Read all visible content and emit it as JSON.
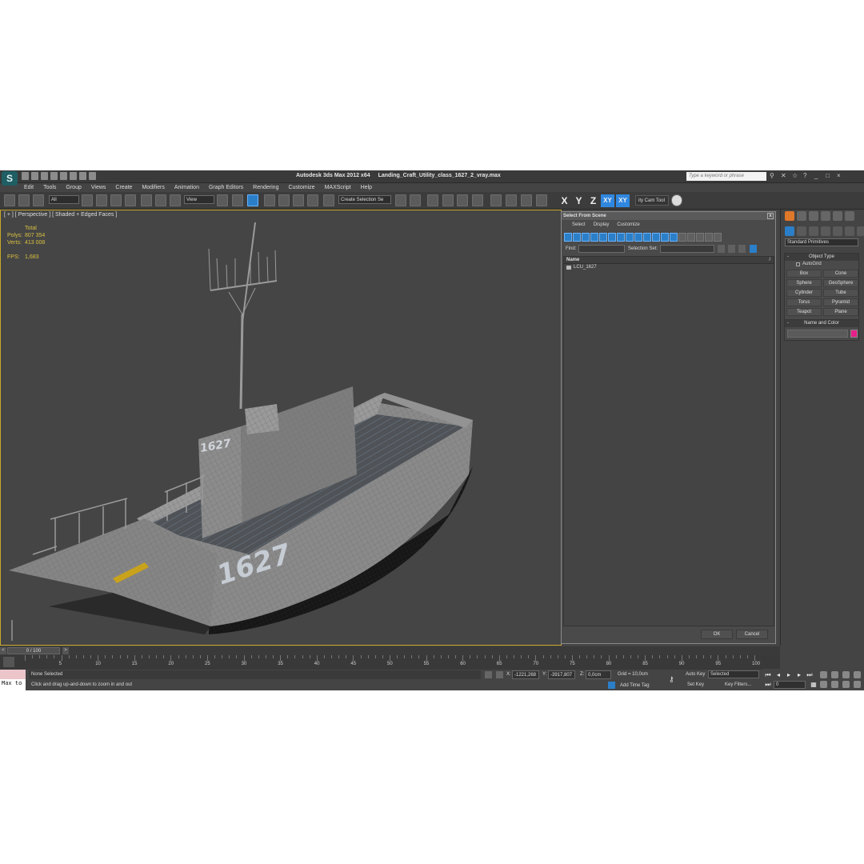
{
  "app": {
    "title": "Autodesk 3ds Max  2012 x64",
    "file": "Landing_Craft_Utility_class_1627_2_vray.max",
    "logo": "S",
    "help_placeholder": "Type a keyword or phrase"
  },
  "menu": [
    "Edit",
    "Tools",
    "Group",
    "Views",
    "Create",
    "Modifiers",
    "Animation",
    "Graph Editors",
    "Rendering",
    "Customize",
    "MAXScript",
    "Help"
  ],
  "toolbar": {
    "selection_filter": "All",
    "ref_coord": "View",
    "selection_set": "Create Selection Se",
    "axes": [
      "X",
      "Y",
      "Z",
      "XY",
      "XY"
    ],
    "cam_tool": "ity Cam Tool"
  },
  "viewport": {
    "label": "[ + ] [ Perspective ] [ Shaded + Edged Faces ]",
    "stats": {
      "total_label": "Total",
      "polys_label": "Polys:",
      "polys": "807 354",
      "verts_label": "Verts:",
      "verts": "413 008",
      "fps_label": "FPS:",
      "fps": "1,683"
    },
    "hull_number": "1627",
    "bridge_number": "1627"
  },
  "dialog": {
    "title": "Select From Scene",
    "close": "x",
    "menu": [
      "Select",
      "Display",
      "Customize"
    ],
    "find_label": "Find:",
    "selection_set_label": "Selection Set:",
    "column_name": "Name",
    "sort": "/",
    "items": [
      "LCU_1627"
    ],
    "ok": "OK",
    "cancel": "Cancel"
  },
  "command_panel": {
    "category": "Standard Primitives",
    "object_type_title": "Object Type",
    "autogrid": "AutoGrid",
    "objects": [
      "Box",
      "Cone",
      "Sphere",
      "GeoSphere",
      "Cylinder",
      "Tube",
      "Torus",
      "Pyramid",
      "Teapot",
      "Plane"
    ],
    "name_color_title": "Name and Color",
    "object_color": "#e51f8a"
  },
  "timeline": {
    "slider": "0 / 100",
    "ticks": [
      "0",
      "5",
      "10",
      "15",
      "20",
      "25",
      "30",
      "35",
      "40",
      "45",
      "50",
      "55",
      "60",
      "65",
      "70",
      "75",
      "80",
      "85",
      "90",
      "95",
      "100"
    ]
  },
  "status": {
    "maxscript": "Max to",
    "selection": "None Selected",
    "prompt": "Click and drag up-and-down to zoom in and out",
    "x_label": "X:",
    "x": "-1221,268",
    "y_label": "Y:",
    "y": "-3917,807",
    "z_label": "Z:",
    "z": "0,0cm",
    "grid": "Grid = 10,0cm",
    "add_time_tag": "Add Time Tag",
    "auto_key": "Auto Key",
    "set_key": "Set Key",
    "key_mode": "Selected",
    "key_filters": "Key Filters...",
    "frame": "0"
  }
}
